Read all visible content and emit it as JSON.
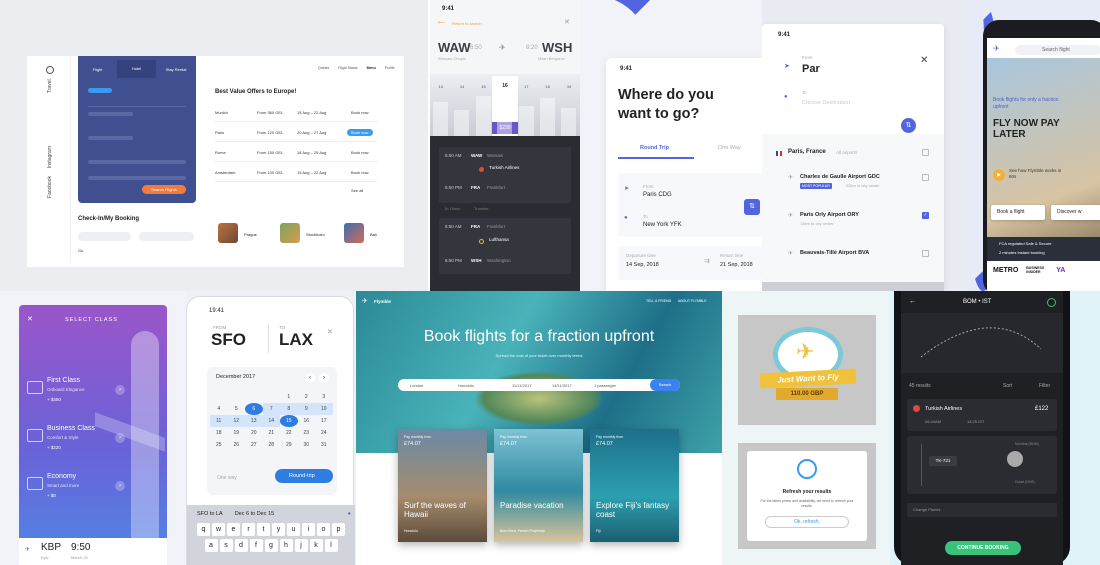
{
  "p1": {
    "vertical": {
      "brand": "Travel.",
      "instagram": "Instagram",
      "facebook": "Facebook"
    },
    "tabs": [
      "Flight",
      "Hotel",
      "Stay Rental"
    ],
    "top_nav": [
      "Quests",
      "Flight Status",
      "Menu",
      "Profile"
    ],
    "form": {
      "cta": "Search Flights"
    },
    "offers_title": "Best Value Offers to Europe!",
    "offers": [
      {
        "city": "Munich",
        "price": "From 360 GEL",
        "dates": "15 Aug – 22 Aug",
        "action": "Book now"
      },
      {
        "city": "Paris",
        "price": "From 120 GEL",
        "dates": "20 Aug – 27 Aug",
        "action": "Book now"
      },
      {
        "city": "Rome",
        "price": "From 150 GEL",
        "dates": "18 Aug – 25 Aug",
        "action": "Book now"
      },
      {
        "city": "Amsterdam",
        "price": "From 100 GEL",
        "dates": "15 Aug – 22 Aug",
        "action": "Book now"
      }
    ],
    "see_all": "See all",
    "checkin_title": "Check-In/My Booking",
    "go": "Go",
    "destinations": [
      "Prague",
      "Stockholm",
      "Bali"
    ]
  },
  "p2": {
    "time": "9:41",
    "return_label": "Return to search",
    "from_code": "WAW",
    "from_time": "6:50",
    "from_city": "Warsaw Chopin",
    "to_code": "WSH",
    "to_time": "8:20",
    "to_city": "Milan Bergamo",
    "days": [
      "13",
      "14",
      "15",
      "16",
      "17",
      "18",
      "19"
    ],
    "price": "$230",
    "leg1": [
      {
        "time": "6:50 AM",
        "code": "WAW",
        "city": "Warsaw"
      },
      {
        "time": "6:50 PM",
        "code": "FRA",
        "city": "Frankfurt"
      }
    ],
    "airline1": "Turkish Airlines",
    "transfer": "1h 15min",
    "transfer_label": "Transfer",
    "leg2": [
      {
        "time": "6:50 AM",
        "code": "FRA",
        "city": "Frankfurt"
      },
      {
        "time": "6:50 PM",
        "code": "WSH",
        "city": "Washington"
      }
    ],
    "airline2": "Lufthansa"
  },
  "p3": {
    "time": "9:41",
    "title": "Where do you want to go?",
    "tab_active": "Round Trip",
    "tab_other": "One Way",
    "from_label": "From",
    "from_value": "Paris CDG",
    "to_label": "To",
    "to_value": "New York YFK",
    "dep_label": "Departure time",
    "dep_value": "14 Sep, 2018",
    "ret_label": "Return time",
    "ret_value": "21 Sep, 2018"
  },
  "p4": {
    "time": "9:41",
    "from_label": "From",
    "from_value": "Par",
    "to_label": "To",
    "to_placeholder": "Choose Destination",
    "city": "Paris, France",
    "city_sub": "All airports",
    "airports": [
      {
        "name": "Charles de Gaulle Airport GDC",
        "badge": "MOST POPULAR",
        "sub": "22km to city center",
        "checked": false
      },
      {
        "name": "Paris Orly Airport ORY",
        "badge": "",
        "sub": "14km to city center",
        "checked": true
      },
      {
        "name": "Beauvais-Tillé Airport BVA",
        "badge": "",
        "sub": "",
        "checked": false
      }
    ]
  },
  "p5": {
    "search": "Search flight",
    "tagline": "Book flights for only a fraction upfront",
    "headline": "FLY NOW PAY LATER",
    "video": "See how Flymble works in 60s",
    "btn1": "Book a flight",
    "btn2": "Discover w",
    "fca": "FCA regulated Safe & Secure",
    "booking": "2 minutes Instant booking",
    "logos": [
      "METRO",
      "BUSINESS INSIDER",
      "YA"
    ]
  },
  "p6": {
    "title": "SELECT CLASS",
    "classes": [
      {
        "name": "First Class",
        "sub": "Onboard Elegance",
        "price": "+ $450"
      },
      {
        "name": "Business Class",
        "sub": "Comfort & Style",
        "price": "+ $220"
      },
      {
        "name": "Economy",
        "sub": "Smart and more",
        "price": "+ $0"
      }
    ],
    "code": "KBP",
    "city": "Kyiv",
    "time": "9:50",
    "date": "March 15"
  },
  "p7": {
    "time": "19:41",
    "from_label": "FROM",
    "from_code": "SFO",
    "to_label": "TO",
    "to_code": "LAX",
    "month": "December 2017",
    "days": [
      [
        "",
        "",
        "",
        "",
        "1",
        "2",
        "3"
      ],
      [
        "4",
        "5",
        "6",
        "7",
        "8",
        "9",
        "10"
      ],
      [
        "11",
        "12",
        "13",
        "14",
        "15",
        "16",
        "17"
      ],
      [
        "18",
        "19",
        "20",
        "21",
        "22",
        "23",
        "24"
      ],
      [
        "25",
        "26",
        "27",
        "28",
        "29",
        "30",
        "31"
      ]
    ],
    "one_way": "One way",
    "round_trip": "Round-trip",
    "suggest_left": "SFO to LA",
    "suggest_mid": "Dec 6 to Dec 15",
    "keys_row1": [
      "q",
      "w",
      "e",
      "r",
      "t",
      "y",
      "u",
      "i",
      "o",
      "p"
    ],
    "keys_row2": [
      "a",
      "s",
      "d",
      "f",
      "g",
      "h",
      "j",
      "k",
      "l"
    ]
  },
  "p8": {
    "brand": "Flymble",
    "nav": [
      "TELL A FRIEND",
      "ABOUT FLYMBLE"
    ],
    "headline": "Book flights for a fraction upfront",
    "subhead": "Spread the cost of your ticket over monthly terms",
    "search": {
      "from": "London",
      "to": "Honolulu",
      "dep": "11/11/2017",
      "ret": "14/11/2017",
      "pax": "1 passenger",
      "btn": "Search"
    },
    "cards": [
      {
        "pay": "Pay monthly from",
        "price": "£74.07",
        "title": "Surf the waves of Hawaii",
        "tag": "Honolulu"
      },
      {
        "pay": "Pay monthly from",
        "price": "£74.07",
        "title": "Paradise vacation",
        "tag": "Bora Bora, French Polynesia"
      },
      {
        "pay": "Pay monthly from",
        "price": "£74.07",
        "title": "Explore Fiji's fantasy coast",
        "tag": "Fiji"
      }
    ]
  },
  "p9": {
    "badge_text": "Just Want to Fly",
    "badge_price": "110.00 GBP",
    "refresh_title": "Refresh your results",
    "refresh_text": "For the latest prices and availability, we need to refresh your results.",
    "refresh_btn": "Ok, refresh."
  },
  "p10": {
    "route": "BOM • IST",
    "results": "45 results",
    "sort": "Sort",
    "filter": "Filter",
    "airline": "Turkish Airlines",
    "price": "£122",
    "dep_time": "06:40AM",
    "arr_time": "14:25 IST",
    "flight_no": "TK-721",
    "city1": "Mumbai (BOM)",
    "city2": "Dubai (DXB)",
    "change": "Change Planes",
    "continue": "CONTINUE BOOKING"
  },
  "colors": {
    "navy": "#3f4f8f",
    "accent": "#5364e0",
    "orange": "#f07b3f",
    "purple": "#6a55c9",
    "dark": "#2b2c31"
  }
}
